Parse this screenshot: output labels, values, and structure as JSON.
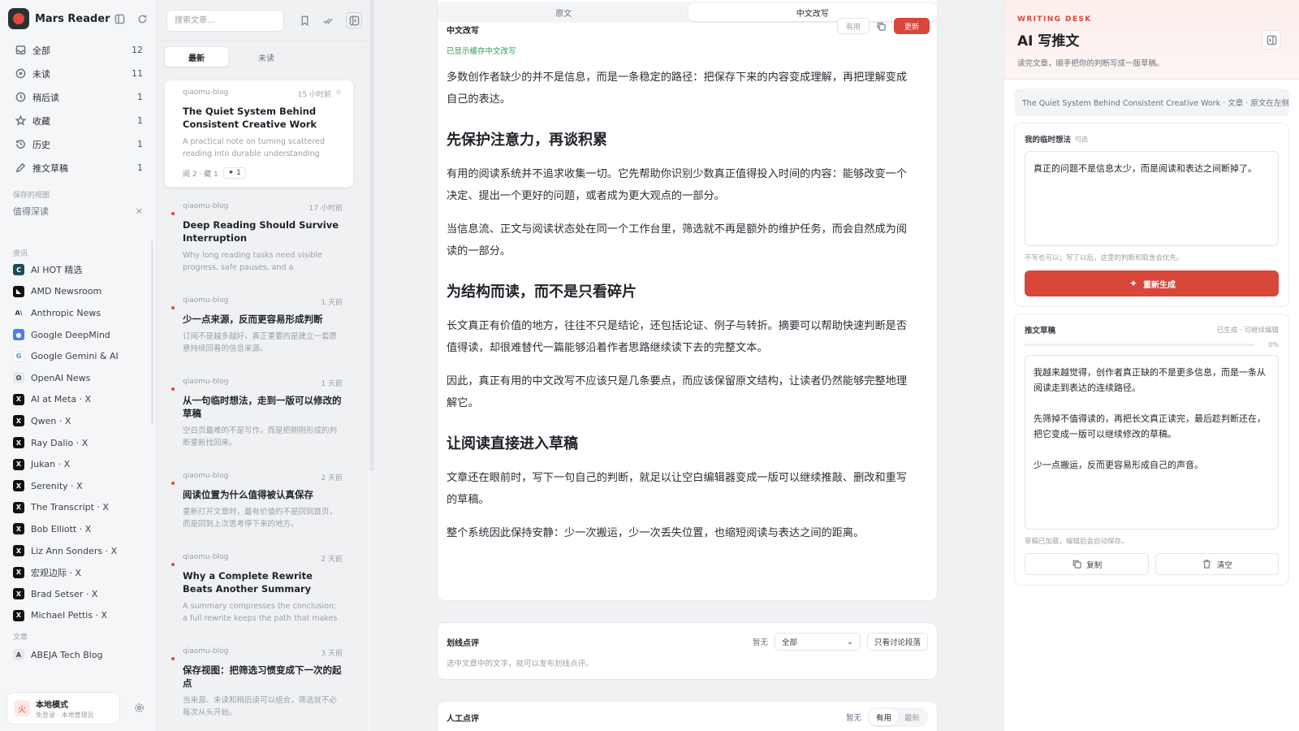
{
  "brand": {
    "name": "Mars Reader"
  },
  "sidebar": {
    "nav": [
      {
        "label": "全部",
        "count": "12",
        "icon": "inbox-icon"
      },
      {
        "label": "未读",
        "count": "11",
        "icon": "circle-dot-icon"
      },
      {
        "label": "稍后读",
        "count": "1",
        "icon": "clock-icon"
      },
      {
        "label": "收藏",
        "count": "1",
        "icon": "star-icon"
      },
      {
        "label": "历史",
        "count": "1",
        "icon": "history-icon"
      },
      {
        "label": "推文草稿",
        "count": "1",
        "icon": "pen-icon"
      }
    ],
    "saved_label": "保存的视图",
    "saved_views": [
      {
        "label": "值得深读"
      }
    ],
    "feeds_label": "资讯",
    "feeds": [
      {
        "label": "AI HOT 精选",
        "badge": "C",
        "color": "#1f4a5a"
      },
      {
        "label": "AMD Newsroom",
        "badge": "◣",
        "color": "#111111"
      },
      {
        "label": "Anthropic News",
        "badge": "A\\",
        "color": "#f5f6f7"
      },
      {
        "label": "Google DeepMind",
        "badge": "●",
        "color": "#4c7df0"
      },
      {
        "label": "Google Gemini & AI",
        "badge": "G",
        "color": "#ffffff"
      },
      {
        "label": "OpenAI News",
        "badge": "O",
        "color": "#e6e8eb"
      },
      {
        "label": "AI at Meta · X",
        "badge": "X",
        "color": "#111111"
      },
      {
        "label": "Qwen · X",
        "badge": "X",
        "color": "#111111"
      },
      {
        "label": "Ray Dalio · X",
        "badge": "X",
        "color": "#111111"
      },
      {
        "label": "Jukan · X",
        "badge": "X",
        "color": "#111111"
      },
      {
        "label": "Serenity · X",
        "badge": "X",
        "color": "#111111"
      },
      {
        "label": "The Transcript · X",
        "badge": "X",
        "color": "#111111"
      },
      {
        "label": "Bob Elliott · X",
        "badge": "X",
        "color": "#111111"
      },
      {
        "label": "Liz Ann Sonders · X",
        "badge": "X",
        "color": "#111111"
      },
      {
        "label": "宏观边际 · X",
        "badge": "X",
        "color": "#111111"
      },
      {
        "label": "Brad Setser · X",
        "badge": "X",
        "color": "#111111"
      },
      {
        "label": "Michael Pettis · X",
        "badge": "X",
        "color": "#111111"
      }
    ],
    "articles_label": "文章",
    "article_feeds": [
      {
        "label": "ABEJA Tech Blog",
        "badge": "A",
        "color": "#e6e8eb"
      }
    ],
    "account": {
      "name": "本地模式",
      "sub": "免登录 · 本地管理员",
      "avatar": "火"
    }
  },
  "list": {
    "search_placeholder": "搜索文章...",
    "tabs": [
      {
        "label": "最新"
      },
      {
        "label": "未读"
      }
    ],
    "items": [
      {
        "source": "qiaomu-blog",
        "time": "15 小时前",
        "title": "The Quiet System Behind Consistent Creative Work",
        "desc": "A practical note on turning scattered reading into durable understanding and...",
        "stats": "阅 2 · 藏 1",
        "chip": "1"
      },
      {
        "source": "qiaomu-blog",
        "time": "17 小时前",
        "title": "Deep Reading Should Survive Interruption",
        "desc": "Why long reading tasks need visible progress, safe pauses, and a dependabl..."
      },
      {
        "source": "qiaomu-blog",
        "time": "1 天前",
        "title": "少一点来源，反而更容易形成判断",
        "desc": "订阅不是越多越好，真正重要的是建立一套愿意持续回看的信息来源。"
      },
      {
        "source": "qiaomu-blog",
        "time": "1 天前",
        "title": "从一句临时想法，走到一版可以修改的草稿",
        "desc": "空白页最难的不是写作，而是把刚刚形成的判断重新找回来。"
      },
      {
        "source": "qiaomu-blog",
        "time": "2 天前",
        "title": "阅读位置为什么值得被认真保存",
        "desc": "重新打开文章时，最有价值的不是回到首页，而是回到上次思考停下来的地方。"
      },
      {
        "source": "qiaomu-blog",
        "time": "2 天前",
        "title": "Why a Complete Rewrite Beats Another Summary",
        "desc": "A summary compresses the conclusion; a full rewrite keeps the path that makes t..."
      },
      {
        "source": "qiaomu-blog",
        "time": "3 天前",
        "title": "保存视图：把筛选习惯变成下一次的起点",
        "desc": "当来源、未读和稍后读可以组合，筛选就不必每次从头开始。"
      }
    ]
  },
  "reader": {
    "tabs": [
      {
        "label": "原文"
      },
      {
        "label": "中文改写"
      }
    ],
    "section_title": "中文改写",
    "useful_label": "有用",
    "update_label": "更新",
    "cache_note": "已显示缓存中文改写",
    "blocks": [
      {
        "type": "p",
        "text": "多数创作者缺少的并不是信息，而是一条稳定的路径：把保存下来的内容变成理解，再把理解变成自己的表达。"
      },
      {
        "type": "h2",
        "text": "先保护注意力，再谈积累"
      },
      {
        "type": "p",
        "text": "有用的阅读系统并不追求收集一切。它先帮助你识别少数真正值得投入时间的内容：能够改变一个决定、提出一个更好的问题，或者成为更大观点的一部分。"
      },
      {
        "type": "p",
        "text": "当信息流、正文与阅读状态处在同一个工作台里，筛选就不再是额外的维护任务，而会自然成为阅读的一部分。"
      },
      {
        "type": "h2",
        "text": "为结构而读，而不是只看碎片"
      },
      {
        "type": "p",
        "text": "长文真正有价值的地方，往往不只是结论，还包括论证、例子与转折。摘要可以帮助快速判断是否值得读，却很难替代一篇能够沿着作者思路继续读下去的完整文本。"
      },
      {
        "type": "p",
        "text": "因此，真正有用的中文改写不应该只是几条要点，而应该保留原文结构，让读者仍然能够完整地理解它。"
      },
      {
        "type": "h2",
        "text": "让阅读直接进入草稿"
      },
      {
        "type": "p",
        "text": "文章还在眼前时，写下一句自己的判断，就足以让空白编辑器变成一版可以继续推敲、删改和重写的草稿。"
      },
      {
        "type": "p",
        "text": "整个系统因此保持安静：少一次搬运，少一次丢失位置，也缩短阅读与表达之间的距离。"
      }
    ]
  },
  "highlights": {
    "title": "划线点评",
    "empty": "暂无",
    "filter_value": "全部",
    "only_discussed": "只看讨论段落",
    "hint": "选中文章中的文字，就可以发布划线点评。"
  },
  "comments": {
    "title": "人工点评",
    "empty": "暂无",
    "sort": [
      {
        "label": "有用"
      },
      {
        "label": "最新"
      }
    ]
  },
  "desk": {
    "eyebrow": "WRITING DESK",
    "title": "AI 写推文",
    "subtitle": "读完文章，顺手把你的判断写成一版草稿。",
    "context": "The Quiet System Behind Consistent Creative Work · 文章 · 原文在左侧",
    "thought_label": "我的临时想法",
    "thought_optional": "可选",
    "thought_value": "真正的问题不是信息太少，而是阅读和表达之间断掉了。",
    "thought_hint": "不写也可以；写了以后，这里的判断和取舍会优先。",
    "regen_label": "重新生成",
    "draft_label": "推文草稿",
    "draft_status": "已生成 · 可继续编辑",
    "draft_progress": 0,
    "draft_progress_label": "0%",
    "draft_value": "我越来越觉得，创作者真正缺的不是更多信息，而是一条从阅读走到表达的连续路径。\n\n先筛掉不值得读的，再把长文真正读完，最后趁判断还在，把它变成一版可以继续修改的草稿。\n\n少一点搬运，反而更容易形成自己的声音。",
    "draft_hint": "草稿已加载，编辑后会自动保存。",
    "copy_label": "复制",
    "clear_label": "清空"
  },
  "colors": {
    "accent": "#d9463a",
    "unread_dot": "#e24a3b",
    "cache_note": "#2e9a5e"
  }
}
